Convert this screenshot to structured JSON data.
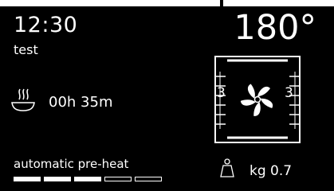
{
  "header": {
    "time": "12:30",
    "program_name": "test",
    "temperature": "180°"
  },
  "cooking": {
    "duration": "00h 35m",
    "icon": "steam-dish-icon"
  },
  "oven": {
    "shelf_left": "3",
    "shelf_right": "3",
    "icon": "convection-fan-icon"
  },
  "preheat": {
    "label": "automatic pre-heat",
    "filled_segments": 3,
    "total_segments": 5
  },
  "weight": {
    "label": "kg 0.7",
    "icon": "weight-icon"
  },
  "colors": {
    "background": "#000000",
    "foreground": "#ffffff"
  }
}
